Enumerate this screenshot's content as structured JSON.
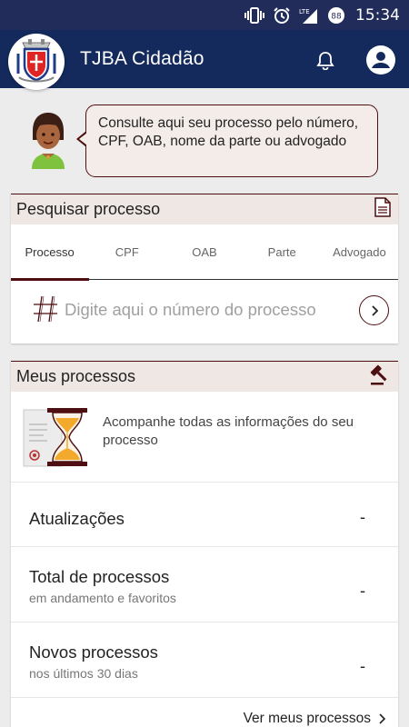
{
  "status_bar": {
    "time": "15:34",
    "icons": [
      "vibrate-icon",
      "alarm-icon",
      "lte-signal-icon",
      "battery-icon"
    ],
    "battery_level": "88"
  },
  "app_bar": {
    "title": "TJBA Cidadão",
    "icons": [
      "tjba-logo",
      "bell-icon",
      "account-icon"
    ],
    "color": "#142a5c"
  },
  "intro": {
    "message": "Consulte aqui seu processo pelo número, CPF, OAB, nome da parte ou advogado"
  },
  "search": {
    "title": "Pesquisar processo",
    "tabs": [
      {
        "label": "Processo",
        "active": true
      },
      {
        "label": "CPF"
      },
      {
        "label": "OAB"
      },
      {
        "label": "Parte"
      },
      {
        "label": "Advogado"
      }
    ],
    "placeholder": "Digite aqui o número do processo"
  },
  "meus": {
    "title": "Meus processos",
    "info": "Acompanhe todas as informações do seu processo",
    "rows": [
      {
        "title": "Atualizações",
        "subtitle": "",
        "value": "-"
      },
      {
        "title": "Total de processos",
        "subtitle": "em andamento e favoritos",
        "value": "-"
      },
      {
        "title": "Novos processos",
        "subtitle": "nos últimos 30 dias",
        "value": "-"
      }
    ],
    "link": "Ver meus processos"
  },
  "colors": {
    "accent": "#4d0f12",
    "header_bg": "#efe7e4",
    "bubble_bg": "#f4ece9"
  }
}
